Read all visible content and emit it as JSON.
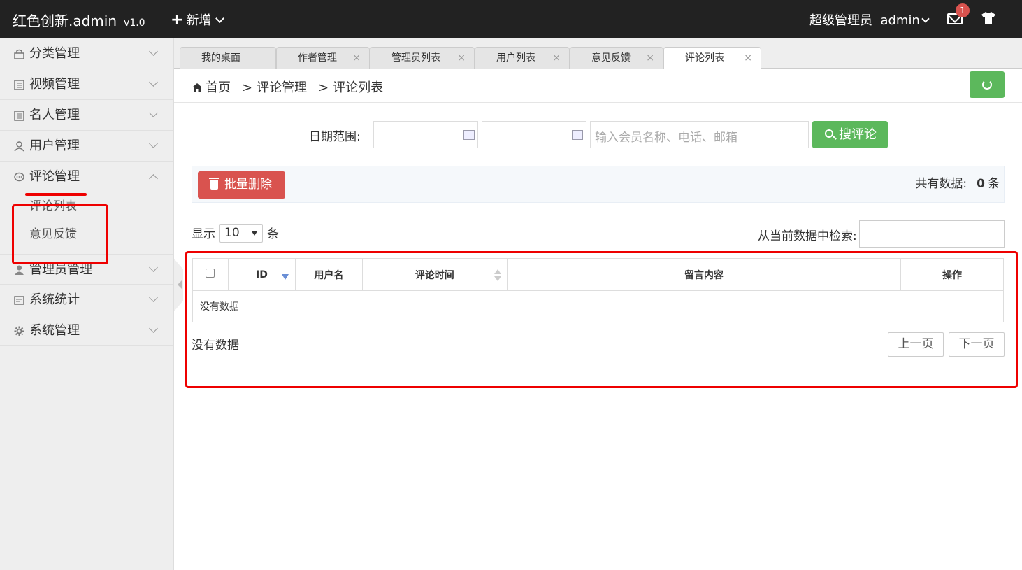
{
  "header": {
    "logo": "红色创新.admin",
    "version": "v1.0",
    "add_label": "新增",
    "user_role": "超级管理员",
    "username": "admin",
    "notification_count": "1"
  },
  "sidebar": {
    "items": [
      {
        "label": "分类管理"
      },
      {
        "label": "视频管理"
      },
      {
        "label": "名人管理"
      },
      {
        "label": "用户管理"
      },
      {
        "label": "评论管理"
      },
      {
        "label": "管理员管理"
      },
      {
        "label": "系统统计"
      },
      {
        "label": "系统管理"
      }
    ],
    "sub_items": [
      {
        "label": "评论列表"
      },
      {
        "label": "意见反馈"
      }
    ]
  },
  "tabs": [
    {
      "label": "我的桌面"
    },
    {
      "label": "作者管理"
    },
    {
      "label": "管理员列表"
    },
    {
      "label": "用户列表"
    },
    {
      "label": "意见反馈"
    },
    {
      "label": "评论列表"
    }
  ],
  "breadcrumb": {
    "home": "首页",
    "sep": ">",
    "level1": "评论管理",
    "level2": "评论列表"
  },
  "search": {
    "date_label": "日期范围:",
    "placeholder": "输入会员名称、电话、邮箱",
    "button": "搜评论"
  },
  "actions": {
    "delete_button": "批量删除",
    "total_label": "共有数据:",
    "total_count": "0",
    "total_unit": "条"
  },
  "list_controls": {
    "show_label": "显示",
    "page_size": "10",
    "unit": "条",
    "filter_label": "从当前数据中检索:"
  },
  "table": {
    "columns": [
      "ID",
      "用户名",
      "评论时间",
      "留言内容",
      "操作"
    ],
    "empty_text": "没有数据"
  },
  "pagination": {
    "info": "没有数据",
    "prev": "上一页",
    "next": "下一页"
  },
  "colors": {
    "header_bg": "#222222",
    "success": "#5cb85c",
    "danger": "#d9534f",
    "highlight": "#ee0000"
  }
}
